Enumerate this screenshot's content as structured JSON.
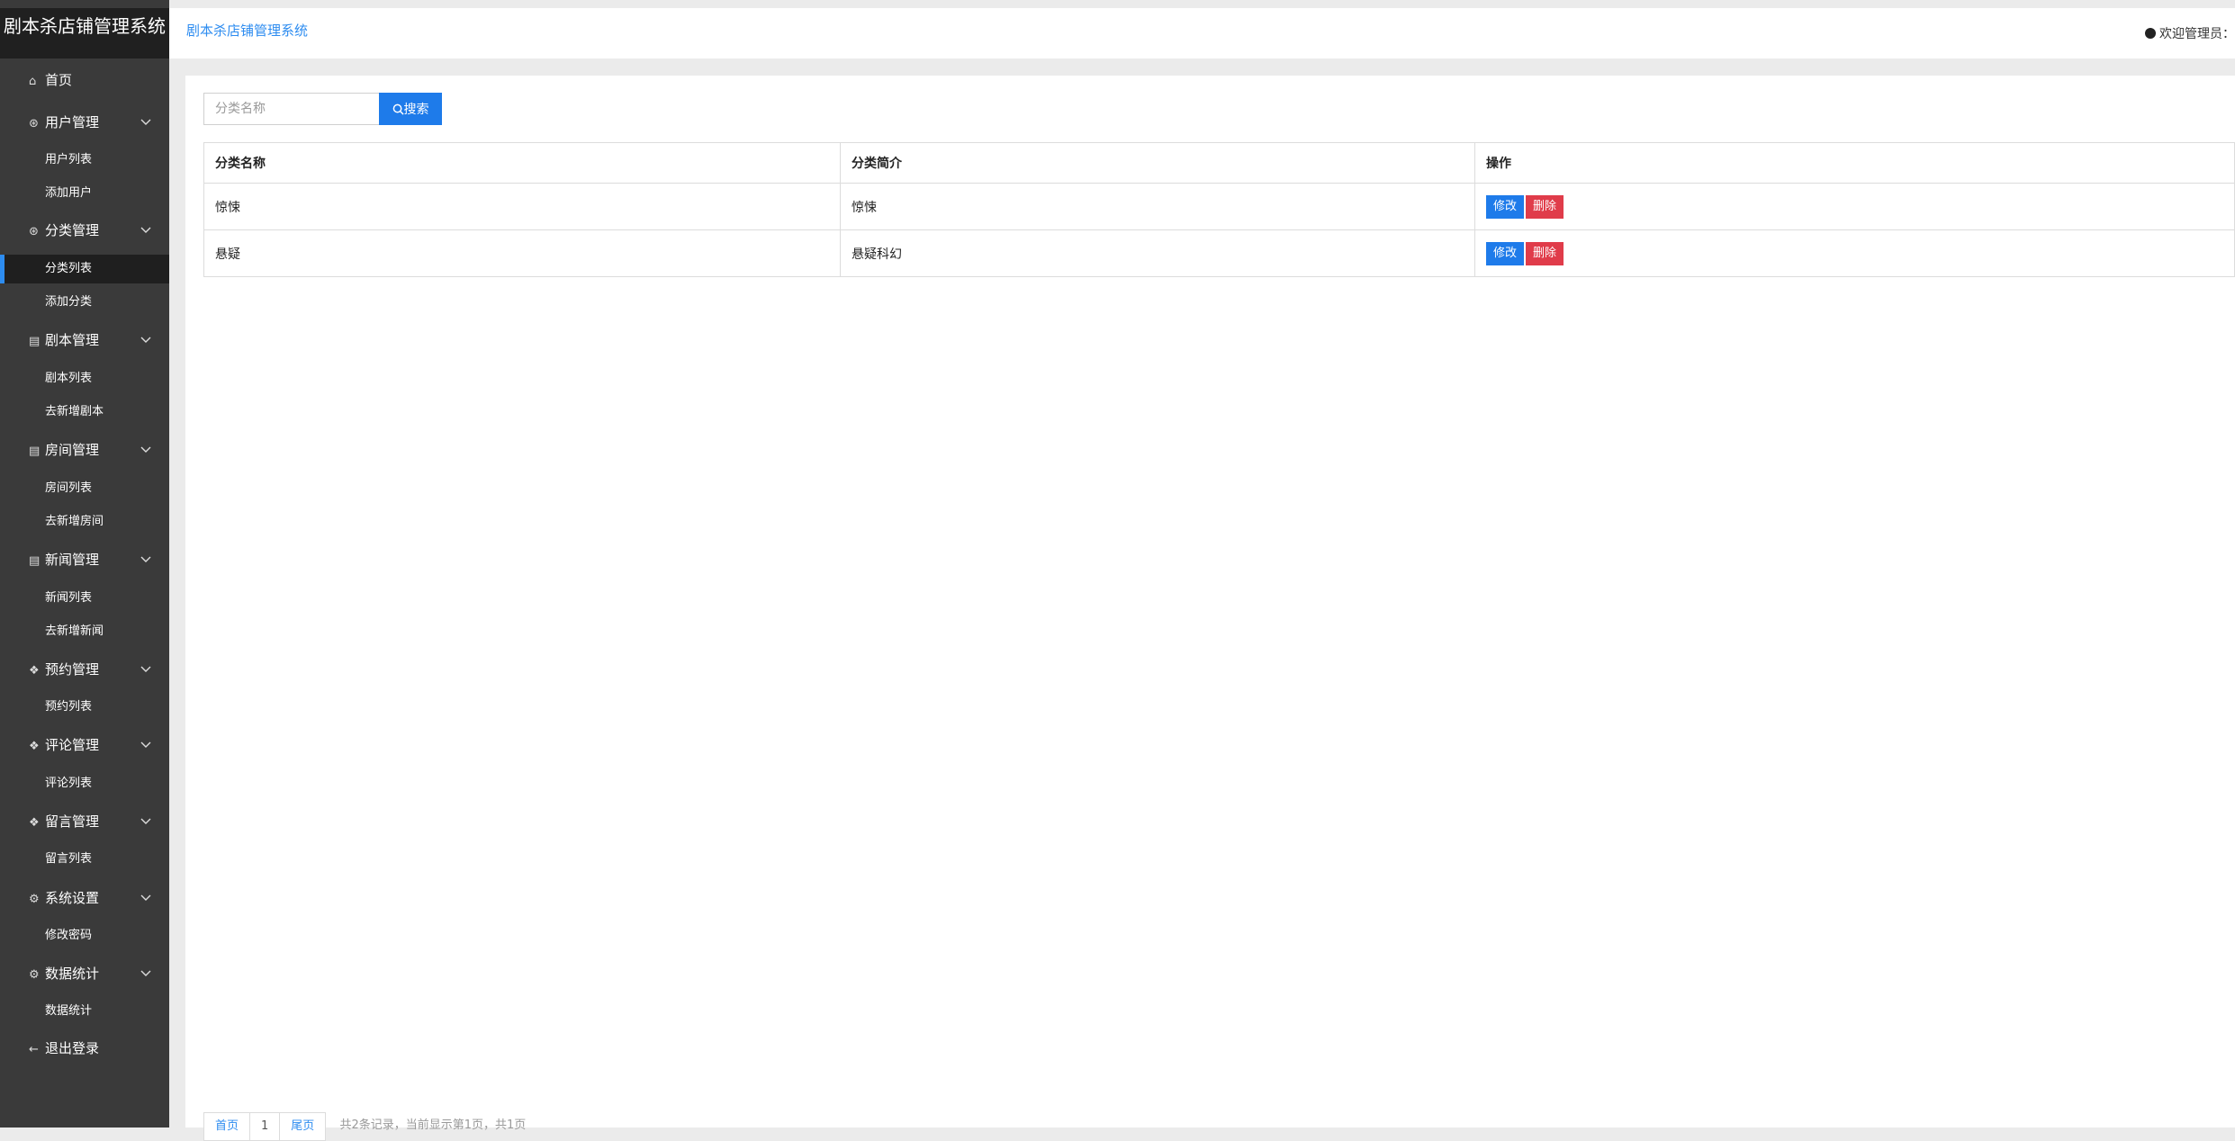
{
  "app": {
    "brand": "剧本杀店铺管理系统",
    "breadcrumb": "剧本杀店铺管理系统",
    "welcome": "欢迎管理员："
  },
  "sidebar": {
    "home": "首页",
    "groups": [
      {
        "label": "用户管理",
        "icon": "user-circle-icon",
        "items": [
          "用户列表",
          "添加用户"
        ]
      },
      {
        "label": "分类管理",
        "icon": "user-circle-icon",
        "items": [
          "分类列表",
          "添加分类"
        ]
      },
      {
        "label": "剧本管理",
        "icon": "document-icon",
        "items": [
          "剧本列表",
          "去新增剧本"
        ]
      },
      {
        "label": "房间管理",
        "icon": "document-icon",
        "items": [
          "房间列表",
          "去新增房间"
        ]
      },
      {
        "label": "新闻管理",
        "icon": "document-icon",
        "items": [
          "新闻列表",
          "去新增新闻"
        ]
      },
      {
        "label": "预约管理",
        "icon": "layers-icon",
        "items": [
          "预约列表"
        ]
      },
      {
        "label": "评论管理",
        "icon": "layers-icon",
        "items": [
          "评论列表"
        ]
      },
      {
        "label": "留言管理",
        "icon": "layers-icon",
        "items": [
          "留言列表"
        ]
      },
      {
        "label": "系统设置",
        "icon": "gear-icon",
        "items": [
          "修改密码"
        ]
      },
      {
        "label": "数据统计",
        "icon": "gear-icon",
        "items": [
          "数据统计"
        ]
      }
    ],
    "logout": "退出登录",
    "active_item": "分类列表"
  },
  "search": {
    "placeholder": "分类名称",
    "value": "",
    "button_label": "搜索"
  },
  "table": {
    "headers": [
      "分类名称",
      "分类简介",
      "操作"
    ],
    "rows": [
      {
        "name": "惊悚",
        "intro": "惊悚"
      },
      {
        "name": "悬疑",
        "intro": "悬疑科幻"
      }
    ],
    "edit_label": "修改",
    "delete_label": "删除"
  },
  "pagination": {
    "first": "首页",
    "page": "1",
    "last": "尾页",
    "info": "共2条记录，当前显示第1页，共1页"
  },
  "colors": {
    "sidebar_bg": "#3a3a3a",
    "accent": "#1e7bea",
    "danger": "#e03c4a"
  }
}
